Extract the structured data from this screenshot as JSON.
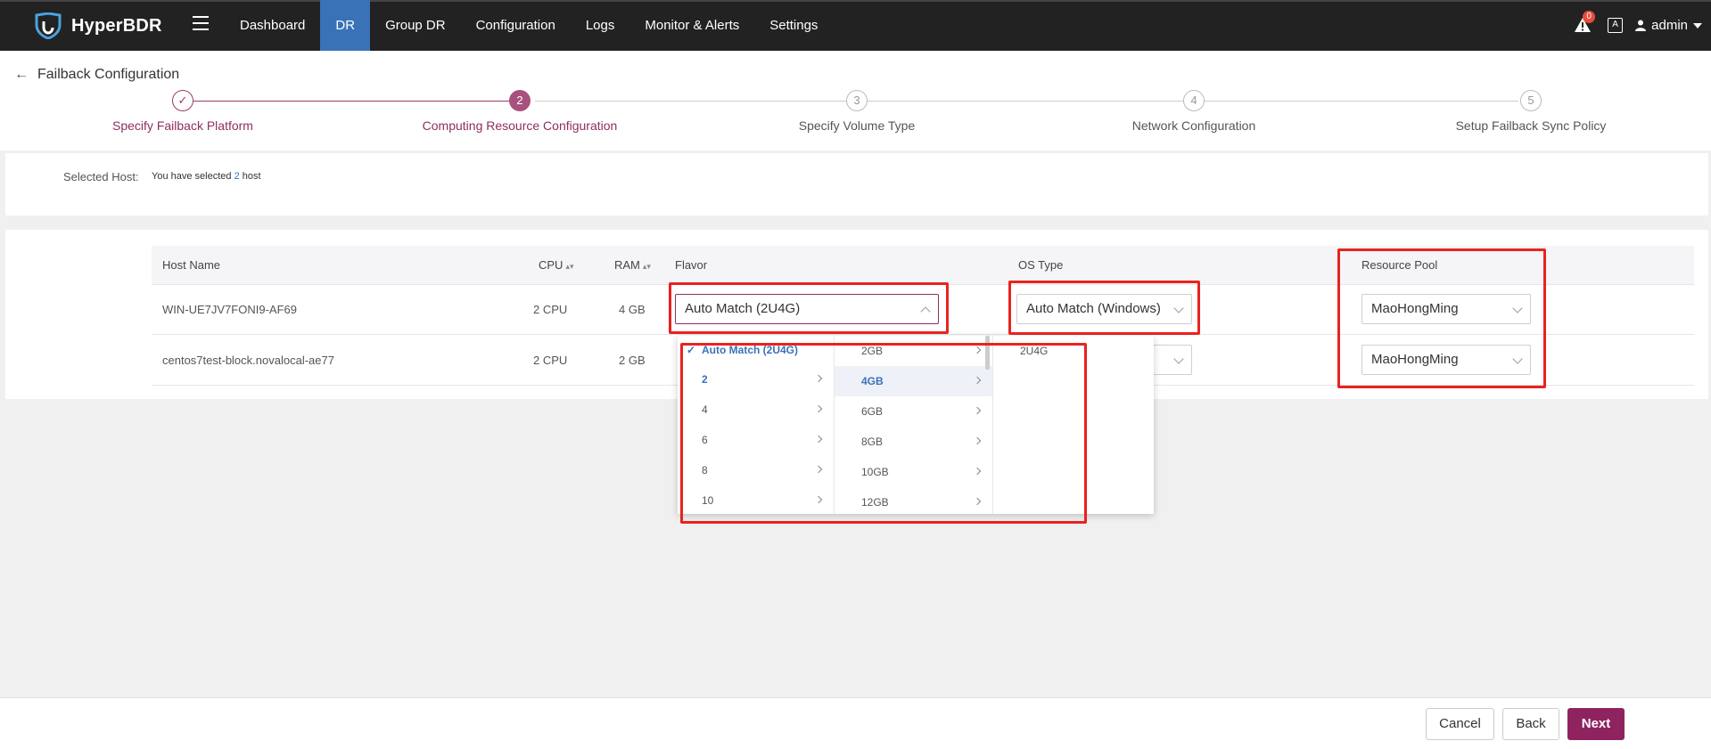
{
  "app": {
    "name": "HyperBDR"
  },
  "nav": {
    "items": [
      "Dashboard",
      "DR",
      "Group DR",
      "Configuration",
      "Logs",
      "Monitor & Alerts",
      "Settings"
    ],
    "active": "DR"
  },
  "topright": {
    "alert_count": "0",
    "lang_glyph": "A",
    "user": "admin"
  },
  "page": {
    "title": "Failback Configuration"
  },
  "steps": [
    {
      "number": "✓",
      "label": "Specify Failback Platform",
      "state": "done"
    },
    {
      "number": "2",
      "label": "Computing Resource Configuration",
      "state": "current"
    },
    {
      "number": "3",
      "label": "Specify Volume Type",
      "state": "todo"
    },
    {
      "number": "4",
      "label": "Network Configuration",
      "state": "todo"
    },
    {
      "number": "5",
      "label": "Setup Failback Sync Policy",
      "state": "todo"
    }
  ],
  "selected_host": {
    "label": "Selected Host:",
    "prefix": "You have selected ",
    "count": "2",
    "suffix": " host"
  },
  "table": {
    "columns": {
      "host_name": "Host Name",
      "cpu": "CPU",
      "ram": "RAM",
      "flavor": "Flavor",
      "os_type": "OS Type",
      "resource_pool": "Resource Pool"
    },
    "rows": [
      {
        "host_name": "WIN-UE7JV7FONI9-AF69",
        "cpu": "2 CPU",
        "ram": "4 GB",
        "flavor": "Auto Match (2U4G)",
        "os_type": "Auto Match (Windows)",
        "resource_pool": "MaoHongMing"
      },
      {
        "host_name": "centos7test-block.novalocal-ae77",
        "cpu": "2 CPU",
        "ram": "2 GB",
        "resource_pool": "MaoHongMing"
      }
    ]
  },
  "cascader": {
    "col1": [
      "Auto Match (2U4G)",
      "2",
      "4",
      "6",
      "8",
      "10"
    ],
    "col2": [
      "2GB",
      "4GB",
      "6GB",
      "8GB",
      "10GB",
      "12GB"
    ],
    "col3": [
      "2U4G"
    ],
    "selected": {
      "col1": "2",
      "col2": "4GB"
    }
  },
  "footer": {
    "cancel": "Cancel",
    "back": "Back",
    "next": "Next"
  },
  "colors": {
    "brand": "#8e2360",
    "nav_active": "#3a72b8",
    "annotation": "#e8231f"
  }
}
